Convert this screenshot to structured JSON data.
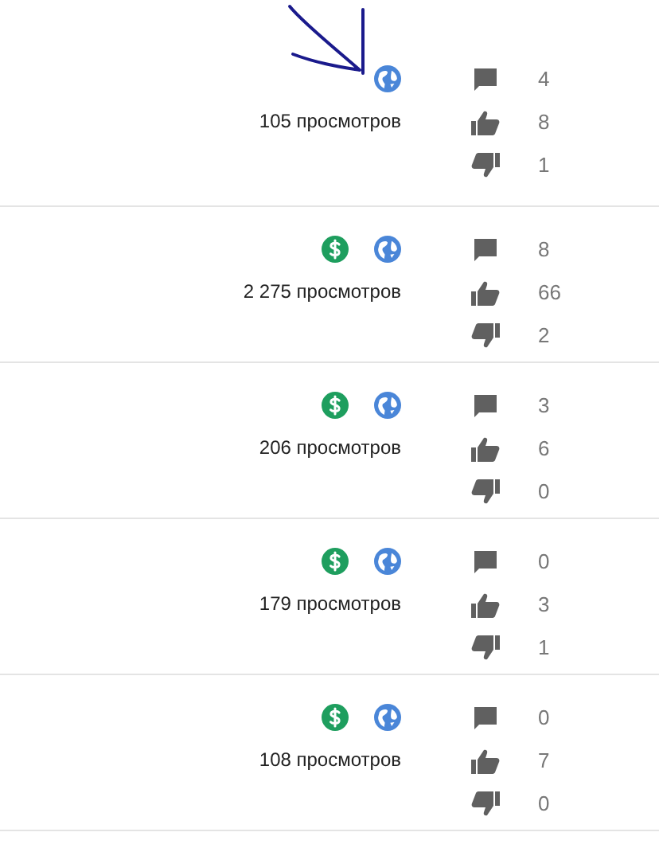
{
  "videos": [
    {
      "monetized": false,
      "views": "105 просмотров",
      "comments": "4",
      "likes": "8",
      "dislikes": "1",
      "annotated": true
    },
    {
      "monetized": true,
      "views": "2 275 просмотров",
      "comments": "8",
      "likes": "66",
      "dislikes": "2",
      "annotated": false
    },
    {
      "monetized": true,
      "views": "206 просмотров",
      "comments": "3",
      "likes": "6",
      "dislikes": "0",
      "annotated": false
    },
    {
      "monetized": true,
      "views": "179 просмотров",
      "comments": "0",
      "likes": "3",
      "dislikes": "1",
      "annotated": false
    },
    {
      "monetized": true,
      "views": "108 просмотров",
      "comments": "0",
      "likes": "7",
      "dislikes": "0",
      "annotated": false
    }
  ]
}
